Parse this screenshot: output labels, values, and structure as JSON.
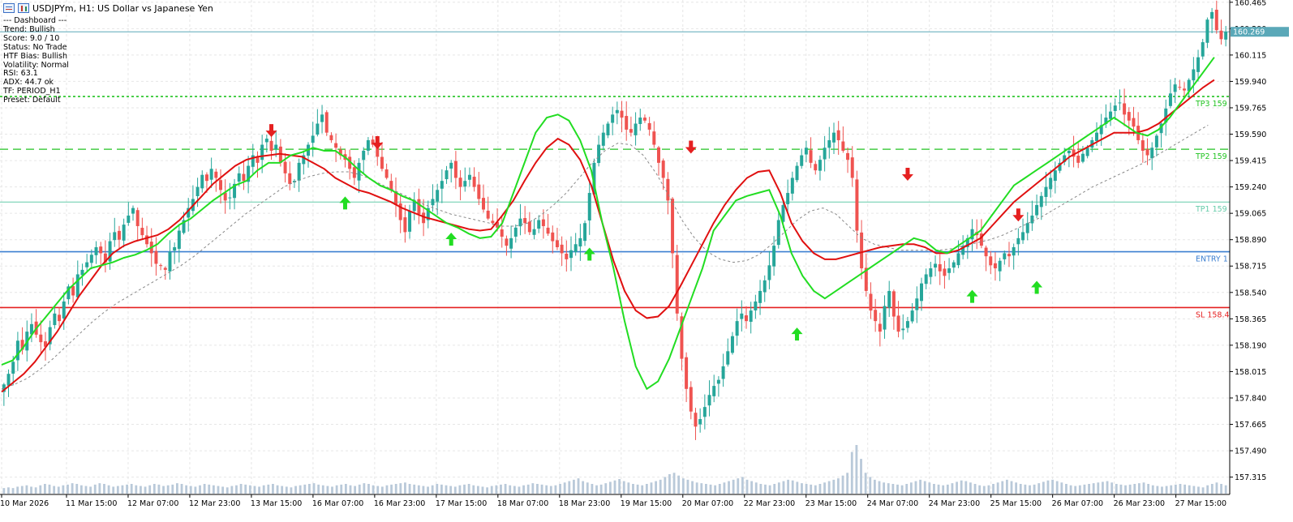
{
  "header": {
    "symbol": "USDJPYm",
    "title": "USDJPYm, H1:  US Dollar vs Japanese Yen"
  },
  "dashboard": {
    "lines": [
      "--- Dashboard ---",
      "Trend: Bullish",
      "Score: 9.0 / 10",
      "Status: No Trade",
      "HTF Bias: Bullish",
      "Volatility: Normal",
      "RSI: 63.1",
      "ADX: 44.7 ok",
      "TF: PERIOD_H1",
      "Preset: Default"
    ]
  },
  "icons": {
    "market_watch": "list-icon",
    "chart_type": "candlestick-icon",
    "buy_signal": "green-up-arrow-icon",
    "sell_signal": "red-down-arrow-icon"
  },
  "colors": {
    "bull_candle": "#26a69a",
    "bear_candle": "#ef5350",
    "fast_ma": "#22dd22",
    "slow_ma": "#e01010",
    "long_ma": "#888888",
    "entry_line": "#3c7fd0",
    "sl_line": "#e52020",
    "tp_line": "#22c322",
    "tp1_line": "#66ccaa",
    "price_line": "#5aa8b8",
    "volume": "#b9c9d9"
  },
  "chart_data": {
    "type": "candlestick",
    "symbol": "USDJPYm",
    "timeframe": "H1",
    "description": "US Dollar vs Japanese Yen",
    "ylim": [
      157.2,
      160.48
    ],
    "y_ticks": [
      "160.465",
      "160.290",
      "160.115",
      "159.940",
      "159.765",
      "159.590",
      "159.415",
      "159.240",
      "159.065",
      "158.890",
      "158.715",
      "158.540",
      "158.365",
      "158.190",
      "158.015",
      "157.840",
      "157.665",
      "157.490",
      "157.315"
    ],
    "x_ticks": [
      "10 Mar 2026",
      "11 Mar 15:00",
      "12 Mar 07:00",
      "12 Mar 23:00",
      "13 Mar 15:00",
      "16 Mar 07:00",
      "16 Mar 23:00",
      "17 Mar 15:00",
      "18 Mar 07:00",
      "18 Mar 23:00",
      "19 Mar 15:00",
      "20 Mar 07:00",
      "22 Mar 23:00",
      "23 Mar 15:00",
      "24 Mar 07:00",
      "24 Mar 23:00",
      "25 Mar 15:00",
      "26 Mar 07:00",
      "26 Mar 23:00",
      "27 Mar 15:00"
    ],
    "current_price": 160.269,
    "current_price_label": "160.269",
    "levels": [
      {
        "name": "TP3",
        "label": "TP3 159",
        "value": 159.84,
        "style": "dotted"
      },
      {
        "name": "TP2",
        "label": "TP2 159",
        "value": 159.49,
        "style": "dashed"
      },
      {
        "name": "TP1",
        "label": "TP1 159",
        "value": 159.14,
        "style": "solid"
      },
      {
        "name": "ENTRY",
        "label": "ENTRY 1",
        "value": 158.81,
        "style": "solid"
      },
      {
        "name": "SL",
        "label": "SL 158.4",
        "value": 158.44,
        "style": "solid"
      }
    ],
    "close": [
      157.93,
      158.0,
      158.08,
      158.22,
      158.16,
      158.28,
      158.33,
      158.26,
      158.21,
      158.18,
      158.31,
      158.4,
      158.35,
      158.48,
      158.58,
      158.52,
      158.66,
      158.69,
      158.74,
      158.79,
      158.84,
      158.8,
      158.74,
      158.88,
      158.94,
      158.89,
      158.99,
      159.05,
      159.1,
      158.98,
      158.92,
      158.86,
      158.8,
      158.73,
      158.72,
      158.69,
      158.81,
      158.84,
      158.95,
      159.02,
      159.1,
      159.16,
      159.24,
      159.32,
      159.28,
      159.36,
      159.3,
      159.22,
      159.15,
      159.17,
      159.26,
      159.33,
      159.28,
      159.38,
      159.45,
      159.4,
      159.52,
      159.56,
      159.48,
      159.52,
      159.4,
      159.33,
      159.26,
      159.28,
      159.4,
      159.45,
      159.52,
      159.58,
      159.66,
      159.72,
      159.6,
      159.55,
      159.5,
      159.45,
      159.42,
      159.36,
      159.3,
      159.4,
      159.48,
      159.55,
      159.52,
      159.44,
      159.36,
      159.3,
      159.22,
      159.12,
      159.02,
      158.94,
      159.08,
      159.15,
      159.06,
      159.0,
      159.1,
      159.16,
      159.22,
      159.28,
      159.35,
      159.4,
      159.3,
      159.24,
      159.28,
      159.32,
      159.24,
      159.16,
      159.09,
      159.03,
      159.0,
      158.97,
      158.91,
      158.85,
      158.9,
      158.97,
      159.03,
      159.0,
      158.94,
      158.96,
      159.02,
      158.98,
      158.93,
      158.88,
      158.84,
      158.8,
      158.76,
      158.82,
      158.86,
      158.9,
      159.0,
      159.2,
      159.4,
      159.52,
      159.6,
      159.66,
      159.72,
      159.75,
      159.7,
      159.62,
      159.6,
      159.66,
      159.7,
      159.68,
      159.62,
      159.52,
      159.4,
      159.3,
      159.15,
      158.8,
      158.4,
      158.1,
      157.9,
      157.75,
      157.65,
      157.7,
      157.78,
      157.86,
      157.92,
      157.96,
      158.05,
      158.15,
      158.25,
      158.35,
      158.4,
      158.35,
      158.42,
      158.48,
      158.55,
      158.62,
      158.72,
      158.85,
      159.02,
      159.12,
      159.2,
      159.3,
      159.38,
      159.45,
      159.5,
      159.4,
      159.35,
      159.42,
      159.5,
      159.55,
      159.6,
      159.55,
      159.48,
      159.42,
      159.3,
      158.95,
      158.7,
      158.55,
      158.42,
      158.35,
      158.28,
      158.45,
      158.55,
      158.38,
      158.28,
      158.3,
      158.35,
      158.42,
      158.5,
      158.6,
      158.66,
      158.7,
      158.73,
      158.68,
      158.65,
      158.7,
      158.74,
      158.8,
      158.85,
      158.9,
      158.96,
      158.92,
      158.85,
      158.78,
      158.72,
      158.7,
      158.75,
      158.8,
      158.78,
      158.84,
      158.9,
      158.94,
      159.0,
      159.05,
      159.12,
      159.18,
      159.24,
      159.3,
      159.35,
      159.4,
      159.45,
      159.48,
      159.44,
      159.4,
      159.46,
      159.5,
      159.55,
      159.6,
      159.65,
      159.7,
      159.74,
      159.78,
      159.8,
      159.72,
      159.68,
      159.64,
      159.55,
      159.48,
      159.45,
      159.5,
      159.58,
      159.66,
      159.76,
      159.86,
      159.92,
      159.9,
      159.88,
      159.95,
      160.02,
      160.1,
      160.2,
      160.35,
      160.4,
      160.28,
      160.22,
      160.27
    ],
    "fast_ma": [
      158.06,
      158.09,
      158.18,
      158.29,
      158.38,
      158.47,
      158.56,
      158.63,
      158.7,
      158.72,
      158.74,
      158.77,
      158.79,
      158.82,
      158.86,
      158.93,
      158.99,
      159.03,
      159.09,
      159.15,
      159.2,
      159.25,
      159.28,
      159.35,
      159.4,
      159.4,
      159.45,
      159.47,
      159.5,
      159.48,
      159.48,
      159.43,
      159.36,
      159.3,
      159.25,
      159.22,
      159.18,
      159.15,
      159.1,
      159.05,
      159.0,
      158.97,
      158.93,
      158.9,
      158.91,
      159.0,
      159.2,
      159.4,
      159.6,
      159.7,
      159.72,
      159.68,
      159.55,
      159.35,
      159.0,
      158.7,
      158.35,
      158.05,
      157.9,
      157.95,
      158.1,
      158.3,
      158.5,
      158.7,
      158.95,
      159.05,
      159.15,
      159.18,
      159.2,
      159.22,
      159.05,
      158.8,
      158.65,
      158.55,
      158.5,
      158.55,
      158.6,
      158.65,
      158.7,
      158.75,
      158.8,
      158.85,
      158.9,
      158.88,
      158.82,
      158.8,
      158.85,
      158.9,
      158.95,
      159.05,
      159.15,
      159.25,
      159.3,
      159.35,
      159.4,
      159.45,
      159.5,
      159.55,
      159.6,
      159.65,
      159.7,
      159.65,
      159.6,
      159.58,
      159.62,
      159.7,
      159.8,
      159.9,
      160.0,
      160.1
    ],
    "slow_ma": [
      157.88,
      157.94,
      158.0,
      158.08,
      158.18,
      158.28,
      158.4,
      158.52,
      158.62,
      158.72,
      158.8,
      158.85,
      158.88,
      158.9,
      158.92,
      158.96,
      159.02,
      159.1,
      159.18,
      159.26,
      159.32,
      159.38,
      159.42,
      159.44,
      159.45,
      159.46,
      159.45,
      159.44,
      159.4,
      159.36,
      159.3,
      159.26,
      159.22,
      159.2,
      159.17,
      159.14,
      159.1,
      159.07,
      159.04,
      159.02,
      159.0,
      158.98,
      158.96,
      158.95,
      158.96,
      159.05,
      159.15,
      159.28,
      159.4,
      159.5,
      159.56,
      159.52,
      159.42,
      159.25,
      159.0,
      158.75,
      158.55,
      158.42,
      158.37,
      158.38,
      158.45,
      158.58,
      158.72,
      158.86,
      159.0,
      159.12,
      159.22,
      159.3,
      159.34,
      159.35,
      159.2,
      159.0,
      158.88,
      158.8,
      158.76,
      158.76,
      158.78,
      158.8,
      158.82,
      158.84,
      158.85,
      158.86,
      158.86,
      158.84,
      158.8,
      158.8,
      158.82,
      158.86,
      158.9,
      158.98,
      159.06,
      159.14,
      159.2,
      159.26,
      159.32,
      159.38,
      159.44,
      159.48,
      159.52,
      159.56,
      159.6,
      159.6,
      159.6,
      159.62,
      159.66,
      159.72,
      159.78,
      159.84,
      159.9,
      159.95
    ],
    "long_ma": [
      157.9,
      157.93,
      157.97,
      158.03,
      158.1,
      158.18,
      158.26,
      158.34,
      158.41,
      158.47,
      158.52,
      158.57,
      158.62,
      158.67,
      158.72,
      158.78,
      158.85,
      158.92,
      158.99,
      159.06,
      159.12,
      159.18,
      159.24,
      159.28,
      159.31,
      159.33,
      159.34,
      159.34,
      159.32,
      159.28,
      159.24,
      159.2,
      159.16,
      159.12,
      159.09,
      159.06,
      159.04,
      159.02,
      159.0,
      158.98,
      158.98,
      159.0,
      159.05,
      159.12,
      159.2,
      159.3,
      159.4,
      159.48,
      159.53,
      159.52,
      159.45,
      159.33,
      159.18,
      159.02,
      158.9,
      158.81,
      158.76,
      158.74,
      158.75,
      158.79,
      158.86,
      158.94,
      159.02,
      159.08,
      159.1,
      159.06,
      158.98,
      158.9,
      158.86,
      158.84,
      158.82,
      158.82,
      158.82,
      158.82,
      158.83,
      158.85,
      158.87,
      158.89,
      158.92,
      158.96,
      159.0,
      159.04,
      159.09,
      159.14,
      159.19,
      159.24,
      159.28,
      159.32,
      159.36,
      159.4,
      159.45,
      159.5,
      159.55,
      159.6,
      159.65
    ],
    "buy_signals": [
      {
        "bar_index": 74,
        "price": 159.22
      },
      {
        "bar_index": 97,
        "price": 158.98
      },
      {
        "bar_index": 127,
        "price": 158.88
      },
      {
        "bar_index": 172,
        "price": 158.35
      },
      {
        "bar_index": 210,
        "price": 158.6
      },
      {
        "bar_index": 224,
        "price": 158.66
      }
    ],
    "sell_signals": [
      {
        "bar_index": 58,
        "price": 159.56
      },
      {
        "bar_index": 81,
        "price": 159.48
      },
      {
        "bar_index": 149,
        "price": 159.45
      },
      {
        "bar_index": 196,
        "price": 159.27
      },
      {
        "bar_index": 220,
        "price": 159.0
      }
    ],
    "volume": [
      8,
      9,
      8,
      10,
      11,
      12,
      10,
      9,
      12,
      14,
      13,
      11,
      10,
      12,
      13,
      15,
      14,
      12,
      11,
      10,
      13,
      15,
      14,
      12,
      10,
      11,
      12,
      13,
      14,
      12,
      11,
      10,
      12,
      14,
      13,
      11,
      12,
      13,
      15,
      14,
      12,
      11,
      10,
      12,
      14,
      13,
      12,
      11,
      10,
      9,
      11,
      12,
      14,
      13,
      12,
      11,
      10,
      12,
      13,
      14,
      12,
      11,
      10,
      9,
      11,
      12,
      13,
      14,
      15,
      13,
      12,
      11,
      10,
      12,
      13,
      14,
      12,
      11,
      13,
      15,
      14,
      12,
      11,
      10,
      12,
      13,
      14,
      15,
      16,
      14,
      13,
      12,
      11,
      10,
      12,
      14,
      13,
      12,
      11,
      10,
      12,
      13,
      14,
      12,
      11,
      10,
      9,
      11,
      12,
      13,
      14,
      12,
      11,
      10,
      12,
      13,
      15,
      14,
      13,
      12,
      11,
      12,
      14,
      16,
      18,
      20,
      22,
      18,
      16,
      14,
      12,
      13,
      15,
      17,
      19,
      21,
      18,
      16,
      14,
      13,
      12,
      14,
      16,
      18,
      20,
      24,
      28,
      30,
      26,
      22,
      20,
      18,
      16,
      15,
      14,
      13,
      12,
      14,
      16,
      18,
      20,
      22,
      24,
      20,
      18,
      16,
      14,
      13,
      12,
      14,
      16,
      18,
      20,
      19,
      17,
      15,
      14,
      13,
      12,
      14,
      16,
      18,
      20,
      22,
      26,
      30,
      60,
      70,
      50,
      30,
      24,
      20,
      18,
      16,
      15,
      14,
      13,
      12,
      14,
      16,
      18,
      20,
      18,
      16,
      14,
      13,
      12,
      13,
      15,
      17,
      19,
      18,
      16,
      14,
      12,
      11,
      12,
      14,
      16,
      18,
      20,
      18,
      16,
      14,
      13,
      12,
      13,
      15,
      17,
      19,
      20,
      18,
      16,
      14,
      12,
      11,
      12,
      13,
      14,
      15,
      16,
      17,
      18,
      16,
      14,
      13,
      12,
      13,
      14,
      15,
      16,
      14,
      12,
      11,
      10,
      11,
      12,
      13,
      14,
      13,
      12,
      11,
      10,
      9,
      12,
      14,
      16,
      14,
      12
    ]
  }
}
